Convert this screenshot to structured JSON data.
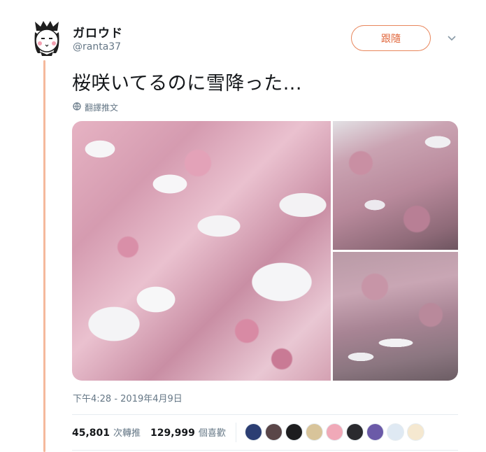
{
  "user": {
    "display_name": "ガロウド",
    "handle": "@ranta37",
    "avatar_icon": "cartoon-avatar-icon"
  },
  "follow_button": {
    "label": "跟隨",
    "accent": "#e0653a",
    "border": "#e8865c"
  },
  "menu": {
    "icon": "chevron-down-icon"
  },
  "tweet": {
    "text": "桜咲いてるのに雪降った...",
    "translate_label": "翻譯推文",
    "translate_icon": "globe-icon"
  },
  "media": {
    "photos": [
      {
        "name": "photo-cherry-blossoms-snow-closeup",
        "description_icon": "photo"
      },
      {
        "name": "photo-cherry-tree-top",
        "description_icon": "photo"
      },
      {
        "name": "photo-cherry-tree-bottom",
        "description_icon": "photo"
      }
    ]
  },
  "timestamp": "下午4:28 - 2019年4月9日",
  "stats": {
    "retweets_count": "45,801",
    "retweets_label": "次轉推",
    "likes_count": "129,999",
    "likes_label": "個喜歡"
  },
  "liker_avatars": [
    {
      "name": "liker-avatar-1",
      "color": "#2c3e73"
    },
    {
      "name": "liker-avatar-2",
      "color": "#5a4648"
    },
    {
      "name": "liker-avatar-3",
      "color": "#1d1d1f"
    },
    {
      "name": "liker-avatar-4",
      "color": "#d8c49a"
    },
    {
      "name": "liker-avatar-5",
      "color": "#f0a9b8"
    },
    {
      "name": "liker-avatar-6",
      "color": "#2a2a2e"
    },
    {
      "name": "liker-avatar-7",
      "color": "#6b5aa8"
    },
    {
      "name": "liker-avatar-8",
      "color": "#dfe9f3"
    },
    {
      "name": "liker-avatar-9",
      "color": "#f5e8d0"
    }
  ],
  "colors": {
    "thread_line": "#f5b99c",
    "text_primary": "#14171a",
    "text_secondary": "#657786",
    "divider": "#e6ecf0"
  }
}
